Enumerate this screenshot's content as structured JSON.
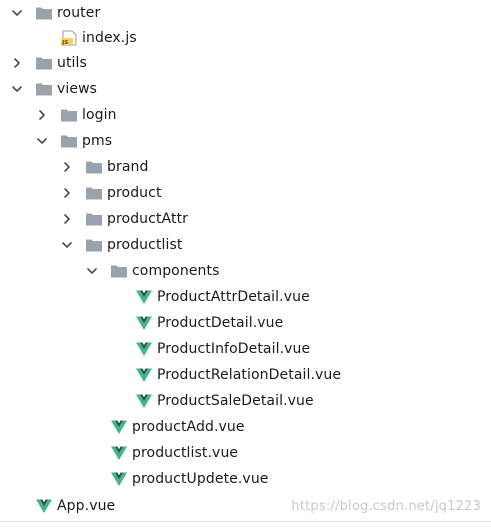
{
  "tree": [
    {
      "label": "router",
      "type": "folder",
      "depth": 0,
      "expanded": true
    },
    {
      "label": "index.js",
      "type": "js",
      "depth": 1
    },
    {
      "label": "utils",
      "type": "folder",
      "depth": 0,
      "expanded": false
    },
    {
      "label": "views",
      "type": "folder",
      "depth": 0,
      "expanded": true
    },
    {
      "label": "login",
      "type": "folder",
      "depth": 1,
      "expanded": false
    },
    {
      "label": "pms",
      "type": "folder",
      "depth": 1,
      "expanded": true
    },
    {
      "label": "brand",
      "type": "folder",
      "depth": 2,
      "expanded": false
    },
    {
      "label": "product",
      "type": "folder",
      "depth": 2,
      "expanded": false
    },
    {
      "label": "productAttr",
      "type": "folder",
      "depth": 2,
      "expanded": false
    },
    {
      "label": "productlist",
      "type": "folder",
      "depth": 2,
      "expanded": true
    },
    {
      "label": "components",
      "type": "folder",
      "depth": 3,
      "expanded": true
    },
    {
      "label": "ProductAttrDetail.vue",
      "type": "vue",
      "depth": 4
    },
    {
      "label": "ProductDetail.vue",
      "type": "vue",
      "depth": 4
    },
    {
      "label": "ProductInfoDetail.vue",
      "type": "vue",
      "depth": 4
    },
    {
      "label": "ProductRelationDetail.vue",
      "type": "vue",
      "depth": 4
    },
    {
      "label": "ProductSaleDetail.vue",
      "type": "vue",
      "depth": 4
    },
    {
      "label": "productAdd.vue",
      "type": "vue",
      "depth": 3
    },
    {
      "label": "productlist.vue",
      "type": "vue",
      "depth": 3
    },
    {
      "label": "productUpdete.vue",
      "type": "vue",
      "depth": 3
    },
    {
      "label": "App.vue",
      "type": "vue",
      "depth": 0
    }
  ],
  "watermark": "https://blog.csdn.net/jq1223",
  "colors": {
    "folder": "#9aa3ad",
    "vue_dark": "#35495e",
    "vue_green": "#41b883",
    "js_bg": "#f4d35e",
    "arrow": "#4d4d4d"
  },
  "icons": {
    "folder": "folder-icon",
    "vue": "vue-file-icon",
    "js": "js-file-icon",
    "expanded": "chevron-down-icon",
    "collapsed": "chevron-right-icon"
  }
}
